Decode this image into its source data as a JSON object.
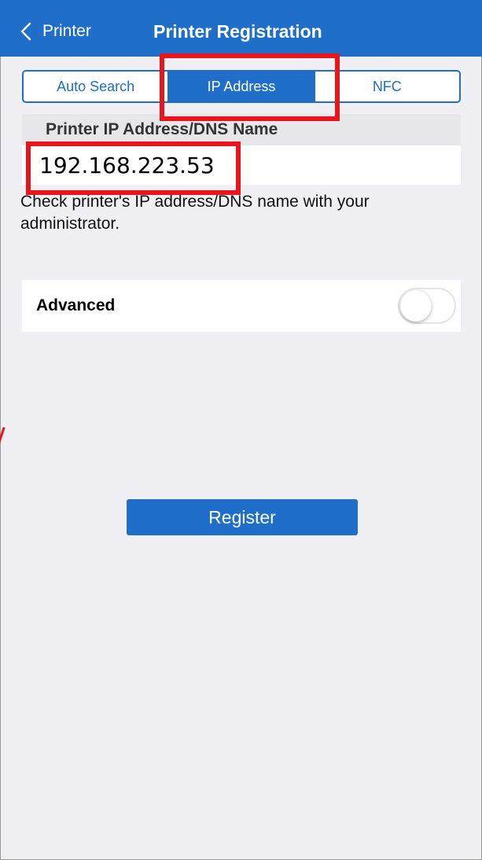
{
  "navbar": {
    "back_label": "Printer",
    "title": "Printer Registration",
    "back_icon": "chevron-left-icon",
    "color": "#1f6ec9"
  },
  "tabs": [
    {
      "label": "Auto Search",
      "active": false
    },
    {
      "label": "IP Address",
      "active": true
    },
    {
      "label": "NFC",
      "active": false
    }
  ],
  "ip_section": {
    "header": "Printer IP Address/DNS Name",
    "value": "192.168.223.53",
    "hint": "Check printer's IP address/DNS name with your administrator."
  },
  "advanced": {
    "label": "Advanced",
    "enabled": false
  },
  "register_button": {
    "label": "Register"
  },
  "annotation_color": "#e8151c"
}
